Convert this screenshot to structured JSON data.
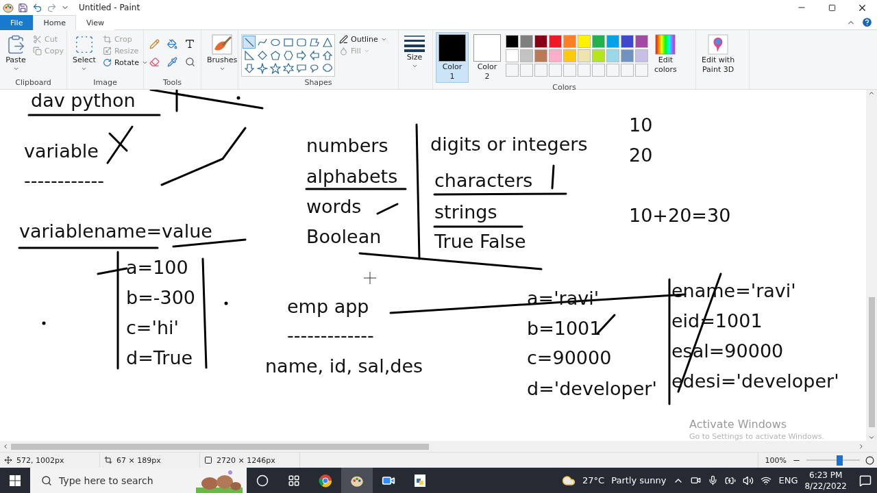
{
  "window": {
    "title": "Untitled - Paint"
  },
  "tabs": [
    {
      "label": "File",
      "kind": "file",
      "selected": false
    },
    {
      "label": "Home",
      "kind": "tab",
      "selected": true
    },
    {
      "label": "View",
      "kind": "tab",
      "selected": false
    }
  ],
  "clipboard": {
    "label": "Clipboard",
    "paste": "Paste",
    "cut": {
      "label": "Cut",
      "disabled": true
    },
    "copy": {
      "label": "Copy",
      "disabled": true
    }
  },
  "image": {
    "label": "Image",
    "select": "Select",
    "crop": {
      "label": "Crop",
      "disabled": true
    },
    "resize": {
      "label": "Resize",
      "disabled": true
    },
    "rotate": {
      "label": "Rotate",
      "disabled": false
    }
  },
  "tools": {
    "label": "Tools"
  },
  "brushes": {
    "label": "Brushes"
  },
  "shapes": {
    "label": "Shapes",
    "outline": {
      "label": "Outline",
      "disabled": false
    },
    "fill": {
      "label": "Fill",
      "disabled": true
    },
    "items": [
      {
        "selected": true
      },
      {
        "selected": false
      },
      {
        "selected": false
      },
      {
        "selected": false
      },
      {
        "selected": false
      },
      {
        "selected": false
      },
      {
        "selected": false
      },
      {
        "selected": false
      },
      {
        "selected": false
      },
      {
        "selected": false
      },
      {
        "selected": false
      },
      {
        "selected": false
      },
      {
        "selected": false
      },
      {
        "selected": false
      },
      {
        "selected": false
      },
      {
        "selected": false
      },
      {
        "selected": false
      },
      {
        "selected": false
      },
      {
        "selected": false
      },
      {
        "selected": false
      },
      {
        "selected": false
      }
    ]
  },
  "size": {
    "label": "Size"
  },
  "colors": {
    "label": "Colors",
    "color1": {
      "label": "Color",
      "number": "1",
      "color": "#000000",
      "selected": true
    },
    "color2": {
      "label": "Color",
      "number": "2",
      "color": "#ffffff",
      "selected": false
    },
    "palette": [
      {
        "color": "#000000"
      },
      {
        "color": "#7f7f7f"
      },
      {
        "color": "#880015"
      },
      {
        "color": "#ed1c24"
      },
      {
        "color": "#ff7f27"
      },
      {
        "color": "#fff200"
      },
      {
        "color": "#22b14c"
      },
      {
        "color": "#00a2e8"
      },
      {
        "color": "#3f48cc"
      },
      {
        "color": "#a349a4"
      },
      {
        "color": "#ffffff"
      },
      {
        "color": "#c3c3c3"
      },
      {
        "color": "#b97a57"
      },
      {
        "color": "#ffaec9"
      },
      {
        "color": "#ffc90e"
      },
      {
        "color": "#efe4b0"
      },
      {
        "color": "#b5e61d"
      },
      {
        "color": "#99d9ea"
      },
      {
        "color": "#7092be"
      },
      {
        "color": "#c8bfe7"
      }
    ],
    "edit_colors": [
      "Edit",
      "colors"
    ]
  },
  "paint3d": [
    "Edit with",
    "Paint 3D"
  ],
  "canvas": {
    "texts": [
      "dav python",
      "variable",
      "------------",
      "variablename=value",
      "a=100",
      "b=-300",
      "c='hi'",
      "d=True",
      "numbers",
      "alphabets",
      "words",
      "Boolean",
      "digits or integers",
      "characters",
      "strings",
      "True False",
      "10",
      "20",
      "10+20=30",
      "emp app",
      "-------------",
      "name, id, sal,des",
      "a='ravi'",
      "b=1001",
      "c=90000",
      "d='developer'",
      "ename='ravi'",
      "eid=1001",
      "esal=90000",
      "edesi='developer'"
    ]
  },
  "activation": {
    "title": "Activate Windows",
    "hint": "Go to Settings to activate Windows."
  },
  "status_bar": {
    "position": "572, 1002px",
    "selection": "67 × 189px",
    "canvas_size": "2720 × 1246px",
    "zoom": "100%",
    "zoom_slider": {
      "level": 0.62
    }
  },
  "taskbar": {
    "search_placeholder": "Type here to search",
    "temperature": "27°C",
    "weather": "Partly sunny",
    "language": "ENG",
    "time": "6:23 PM",
    "date": "8/22/2022"
  }
}
